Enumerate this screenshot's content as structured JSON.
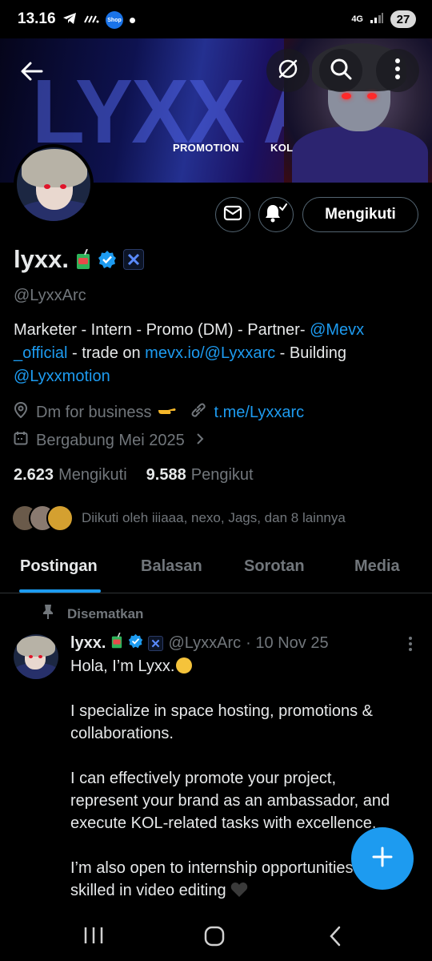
{
  "status_bar": {
    "time": "13.16",
    "shop_badge": "Shop",
    "network": "4G",
    "battery": "27"
  },
  "banner": {
    "title": "LYXX ARC",
    "tag_left": "PROMOTION",
    "tag_right": "KOL"
  },
  "profile": {
    "display_name": "lyxx.",
    "handle": "@LyxxArc",
    "bio": {
      "part1": "Marketer - Intern - Promo (DM) - Partner- ",
      "link1": "@Mevx _official",
      "part2": " - trade on ",
      "link2": "mevx.io/@Lyxxarc",
      "part3": " - Building ",
      "link3": "@Lyxxmotion"
    },
    "location": "Dm for business",
    "website": "t.me/Lyxxarc",
    "joined": "Bergabung Mei 2025",
    "following_count": "2.623",
    "following_label": "Mengikuti",
    "followers_count": "9.588",
    "followers_label": "Pengikut",
    "followed_by": "Diikuti oleh iiiaaa, nexo, Jags, dan 8 lainnya"
  },
  "actions": {
    "follow_label": "Mengikuti"
  },
  "tabs": [
    {
      "label": "Postingan"
    },
    {
      "label": "Balasan"
    },
    {
      "label": "Sorotan"
    },
    {
      "label": "Media"
    }
  ],
  "post": {
    "pinned_label": "Disematkan",
    "name": "lyxx.",
    "handle": "@LyxxArc",
    "date": "· 10 Nov 25",
    "paragraphs": [
      "Hola, I’m Lyxx.",
      "I specialize in space hosting, promotions & collaborations.",
      "I can effectively promote your project, represent your brand as an ambassador, and execute KOL-related tasks with excellence.",
      "I’m also open to internship opportunities and skilled in video editing"
    ]
  },
  "colors": {
    "accent": "#1d9bf0",
    "muted": "#71767b",
    "text": "#e7e9ea",
    "background": "#000000"
  }
}
